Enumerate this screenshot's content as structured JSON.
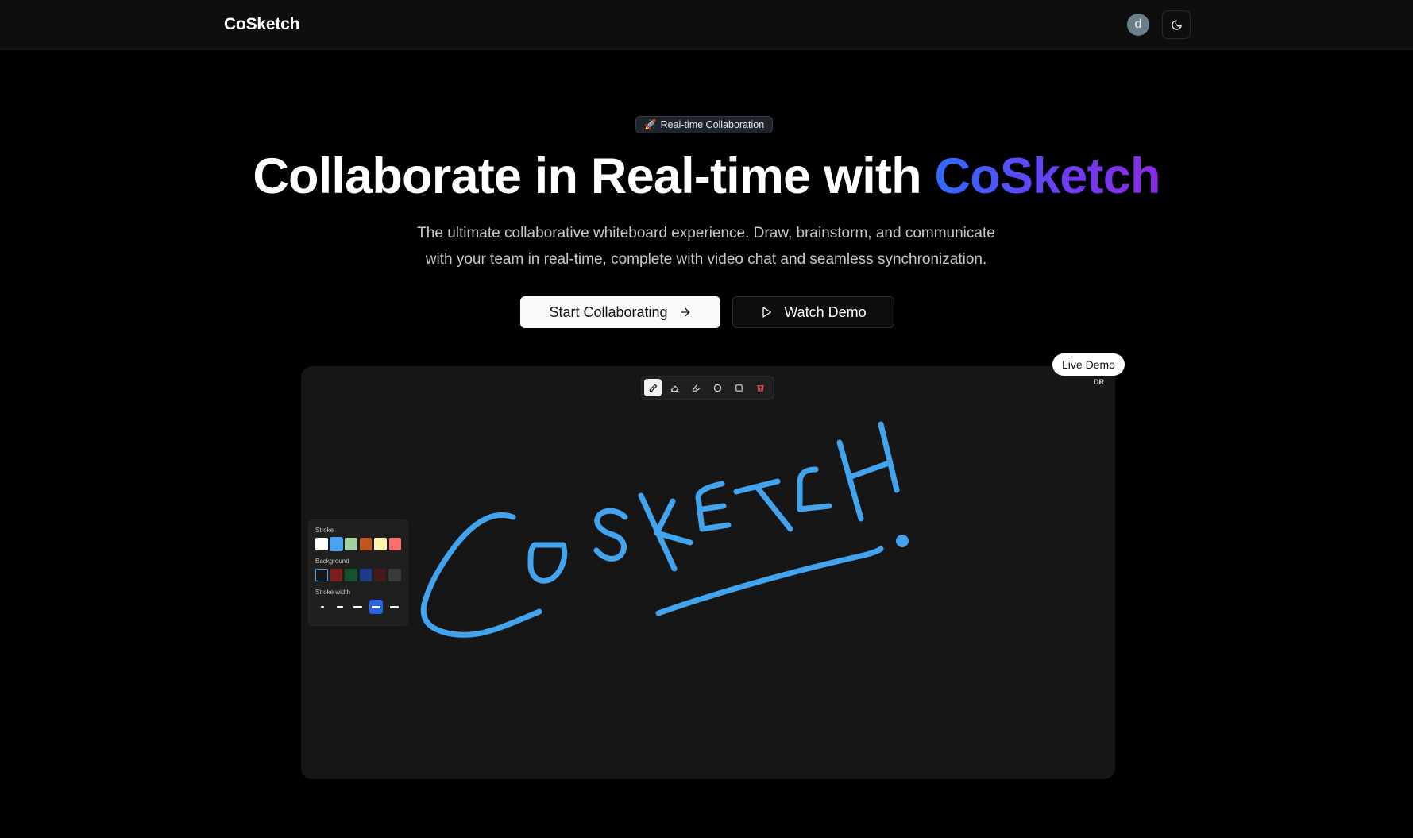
{
  "nav": {
    "brand": "CoSketch",
    "avatar_initial": "d",
    "theme_toggle_icon": "moon-icon"
  },
  "hero": {
    "badge_emoji": "🚀",
    "badge_text": "Real-time Collaboration",
    "title_main": "Collaborate in Real-time with ",
    "title_accent": "CoSketch",
    "subtitle_line1": "The ultimate collaborative whiteboard experience. Draw, brainstorm, and communicate",
    "subtitle_line2": "with your team in real-time, complete with video chat and seamless synchronization.",
    "primary_cta": "Start Collaborating",
    "primary_cta_icon": "arrow-right-icon",
    "secondary_cta": "Watch Demo",
    "secondary_cta_icon": "play-icon"
  },
  "demo": {
    "live_label": "Live Demo",
    "presence_initials": "DR",
    "toolbar": [
      {
        "name": "pencil-icon",
        "active": true
      },
      {
        "name": "eraser-icon",
        "active": false
      },
      {
        "name": "highlighter-icon",
        "active": false
      },
      {
        "name": "circle-icon",
        "active": false
      },
      {
        "name": "rectangle-icon",
        "active": false
      },
      {
        "name": "trash-icon",
        "active": false
      }
    ],
    "properties": {
      "stroke_label": "Stroke",
      "background_label": "Background",
      "stroke_width_label": "Stroke width",
      "stroke_colors": [
        "#ffffff",
        "#4aa3f0",
        "#9fd39b",
        "#c05621",
        "#fef3b0",
        "#f87171"
      ],
      "background_colors": [
        "#161616",
        "#7f1d1d",
        "#14532d",
        "#1e3a8a",
        "#451a1a",
        "#3a3a3a"
      ],
      "selected_stroke_width_index": 3
    },
    "drawing_color": "#42a3ee"
  },
  "colors": {
    "accent_start": "#2f6bff",
    "accent_end": "#8a2be2",
    "background": "#000000"
  }
}
